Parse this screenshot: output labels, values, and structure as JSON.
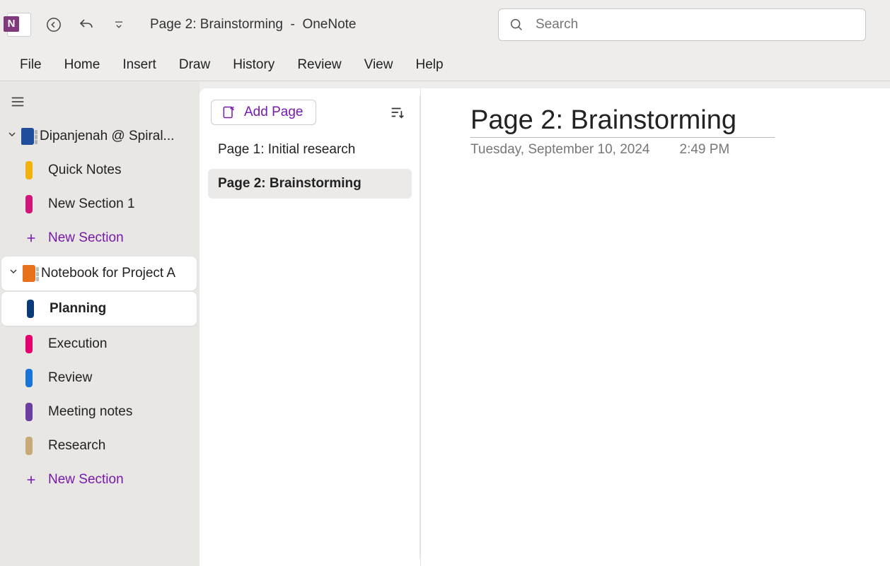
{
  "window": {
    "title_page": "Page 2: Brainstorming",
    "title_app": "OneNote"
  },
  "search": {
    "placeholder": "Search"
  },
  "menus": [
    "File",
    "Home",
    "Insert",
    "Draw",
    "History",
    "Review",
    "View",
    "Help"
  ],
  "nav": {
    "notebooks": [
      {
        "name": "Dipanjenah @ Spiral...",
        "color": "nb-blue",
        "expanded": true,
        "active": false,
        "sections": [
          "Quick Notes",
          "New Section 1"
        ],
        "colors": [
          "c-yellow",
          "c-magenta"
        ],
        "activeIndex": -1
      },
      {
        "name": "Notebook for Project A",
        "color": "nb-orange",
        "expanded": true,
        "active": true,
        "sections": [
          "Planning",
          "Execution",
          "Review",
          "Meeting notes",
          "Research"
        ],
        "colors": [
          "c-navy",
          "c-pink",
          "c-blue",
          "c-purple",
          "c-tan"
        ],
        "activeIndex": 0
      }
    ],
    "newSection": "New Section"
  },
  "pagelist": {
    "addPage": "Add Page",
    "pages": [
      "Page 1: Initial research",
      "Page 2: Brainstorming"
    ],
    "selected": 1
  },
  "canvas": {
    "title": "Page 2: Brainstorming",
    "date": "Tuesday, September 10, 2024",
    "time": "2:49 PM"
  }
}
